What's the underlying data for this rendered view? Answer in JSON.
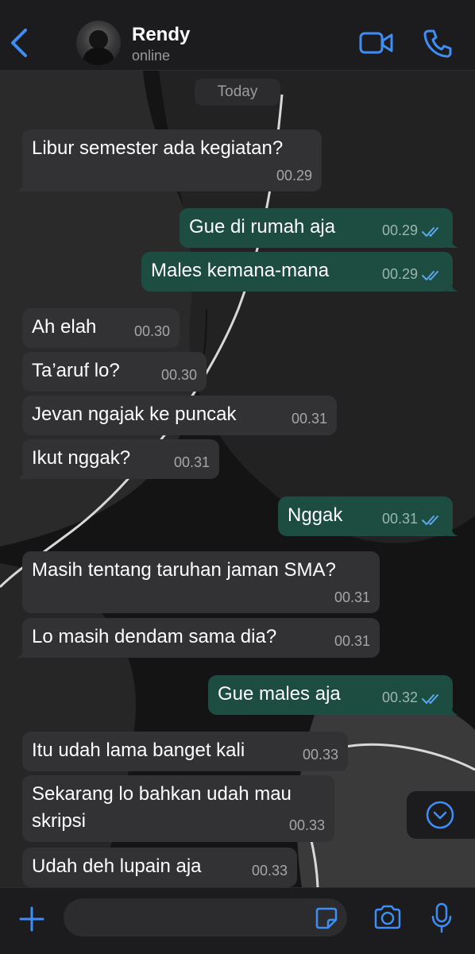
{
  "header": {
    "contact_name": "Rendy",
    "contact_status": "online"
  },
  "chat": {
    "date_label": "Today",
    "messages": [
      {
        "dir": "in",
        "text": "Libur semester ada kegiatan?",
        "time": "00.29"
      },
      {
        "dir": "out",
        "text": "Gue di rumah aja",
        "time": "00.29"
      },
      {
        "dir": "out",
        "text": "Males kemana-mana",
        "time": "00.29"
      },
      {
        "dir": "in",
        "text": "Ah elah",
        "time": "00.30"
      },
      {
        "dir": "in",
        "text": "Ta’aruf lo?",
        "time": "00.30"
      },
      {
        "dir": "in",
        "text": "Jevan ngajak ke puncak",
        "time": "00.31"
      },
      {
        "dir": "in",
        "text": "Ikut nggak?",
        "time": "00.31"
      },
      {
        "dir": "out",
        "text": "Nggak",
        "time": "00.31"
      },
      {
        "dir": "in",
        "text": "Masih tentang taruhan jaman SMA?",
        "time": "00.31"
      },
      {
        "dir": "in",
        "text": "Lo masih dendam sama dia?",
        "time": "00.31"
      },
      {
        "dir": "out",
        "text": "Gue males aja",
        "time": "00.32"
      },
      {
        "dir": "in",
        "text": "Itu udah lama banget kali",
        "time": "00.33"
      },
      {
        "dir": "in",
        "text_line1": "Sekarang lo bahkan udah mau",
        "text_line2": "skripsi",
        "time": "00.33"
      },
      {
        "dir": "in",
        "text": "Udah deh lupain aja",
        "time": "00.33"
      }
    ]
  },
  "composer": {
    "placeholder": ""
  },
  "icons": {
    "back": "chevron-left-icon",
    "video": "video-camera-icon",
    "call": "phone-icon",
    "add": "plus-icon",
    "sticker": "sticker-icon",
    "camera": "camera-icon",
    "mic": "microphone-icon",
    "scroll": "chevron-down-circle-icon"
  },
  "colors": {
    "accent": "#3e8ef7",
    "incoming_bubble": "#323234",
    "outgoing_bubble": "#1d4c40",
    "read_ticks": "#5aa9f0",
    "bar_background": "#1c1c1e"
  }
}
